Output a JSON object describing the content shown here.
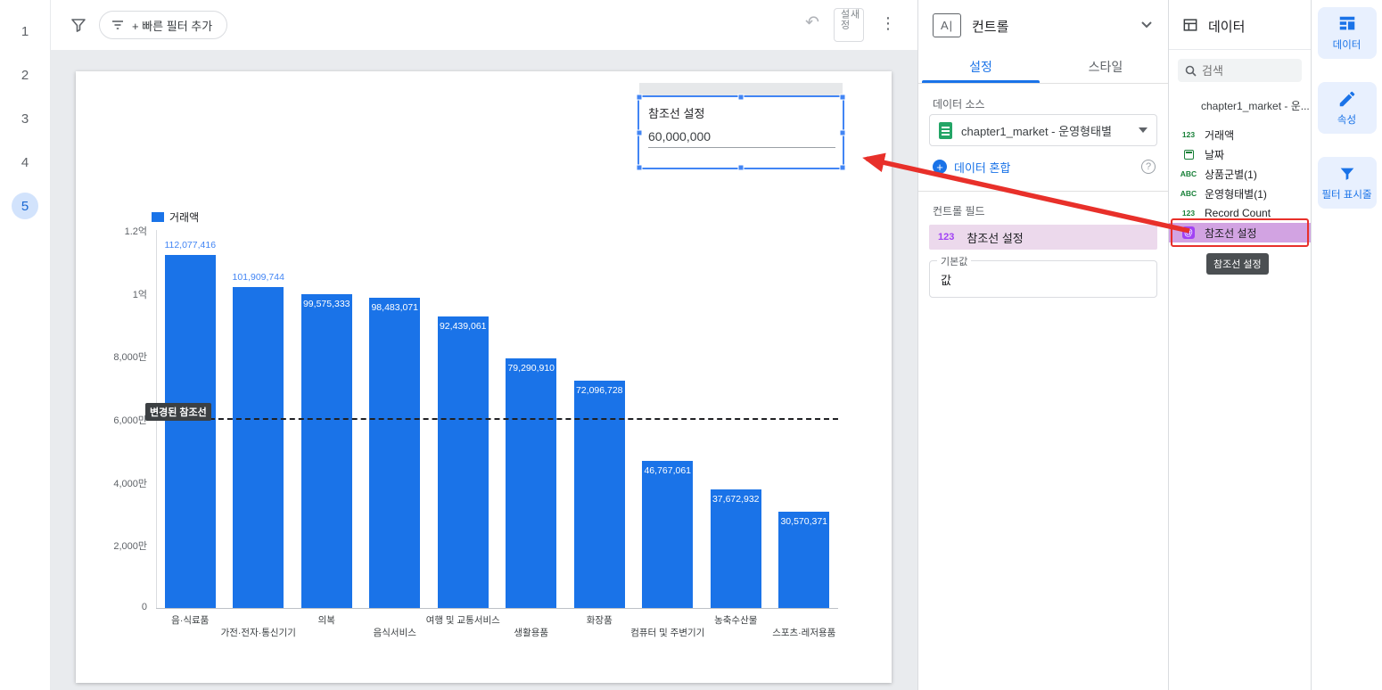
{
  "colors": {
    "accent_blue": "#1a73e8",
    "bar_blue": "#1a73e8",
    "annotation_red": "#e8302a",
    "field_green": "#188038",
    "parameter_purple": "#a142f4",
    "selected_page_bg": "#d2e3fc"
  },
  "page_nav": {
    "items": [
      "1",
      "2",
      "3",
      "4",
      "5"
    ],
    "selected": "5"
  },
  "toolbar": {
    "quick_filter_label": "+ 빠른 필터 추가",
    "new_setting_label": "새 설정"
  },
  "control_widget": {
    "label": "참조선 설정",
    "value": "60,000,000"
  },
  "control_panel": {
    "title": "컨트롤",
    "tabs": [
      {
        "label": "설정",
        "active": true
      },
      {
        "label": "스타일",
        "active": false
      }
    ],
    "data_source_label": "데이터 소스",
    "data_source_name": "chapter1_market - 운영형태별",
    "blend_link": "데이터 혼합",
    "control_field_label": "컨트롤 필드",
    "control_field": {
      "type": "123",
      "name": "참조선 설정"
    },
    "default_value_label": "기본값",
    "default_value_text": "값"
  },
  "data_panel": {
    "title": "데이터",
    "search_placeholder": "검색",
    "source_name": "chapter1_market - 운...",
    "fields": [
      {
        "icon": "123",
        "label": "거래액",
        "highlighted": false
      },
      {
        "icon": "calendar",
        "label": "날짜",
        "highlighted": false
      },
      {
        "icon": "ABC",
        "label": "상품군별(1)",
        "highlighted": false
      },
      {
        "icon": "ABC",
        "label": "운영형태별(1)",
        "highlighted": false
      },
      {
        "icon": "123",
        "label": "Record Count",
        "highlighted": false
      },
      {
        "icon": "@",
        "label": "참조선 설정",
        "highlighted": true
      }
    ],
    "tooltip": "참조선 설정"
  },
  "right_sidebar": {
    "items": [
      {
        "icon": "data-table",
        "label": "데이터"
      },
      {
        "icon": "pencil",
        "label": "속성"
      },
      {
        "icon": "funnel",
        "label": "필터 표시줄"
      }
    ]
  },
  "chart_data": {
    "type": "bar",
    "title": "",
    "legend": [
      "거래액"
    ],
    "categories": [
      "음·식료품",
      "가전·전자·통신기기",
      "의복",
      "음식서비스",
      "여행 및 교통서비스",
      "생활용품",
      "화장품",
      "컴퓨터 및 주변기기",
      "농축수산물",
      "스포츠·레저용품"
    ],
    "values": [
      112077416,
      101909744,
      99575333,
      98483071,
      92439061,
      79290910,
      72096728,
      46767061,
      37672932,
      30570371
    ],
    "value_labels": [
      "112,077,416",
      "101,909,744",
      "99,575,333",
      "98,483,071",
      "92,439,061",
      "79,290,910",
      "72,096,728",
      "46,767,061",
      "37,672,932",
      "30,570,371"
    ],
    "label_positions": [
      "above",
      "above",
      "inside",
      "inside",
      "inside",
      "inside",
      "inside",
      "inside",
      "inside",
      "inside"
    ],
    "y_ticks": [
      {
        "value": 0,
        "label": "0"
      },
      {
        "value": 20000000,
        "label": "2,000만"
      },
      {
        "value": 40000000,
        "label": "4,000만"
      },
      {
        "value": 60000000,
        "label": "6,000만"
      },
      {
        "value": 80000000,
        "label": "8,000만"
      },
      {
        "value": 100000000,
        "label": "1억"
      },
      {
        "value": 120000000,
        "label": "1.2억"
      }
    ],
    "ylim": [
      0,
      120000000
    ],
    "grid": false,
    "legend_position": "top-left",
    "reference_line": {
      "value": 60000000,
      "label": "변경된 참조선"
    },
    "bar_color": "#1a73e8"
  }
}
